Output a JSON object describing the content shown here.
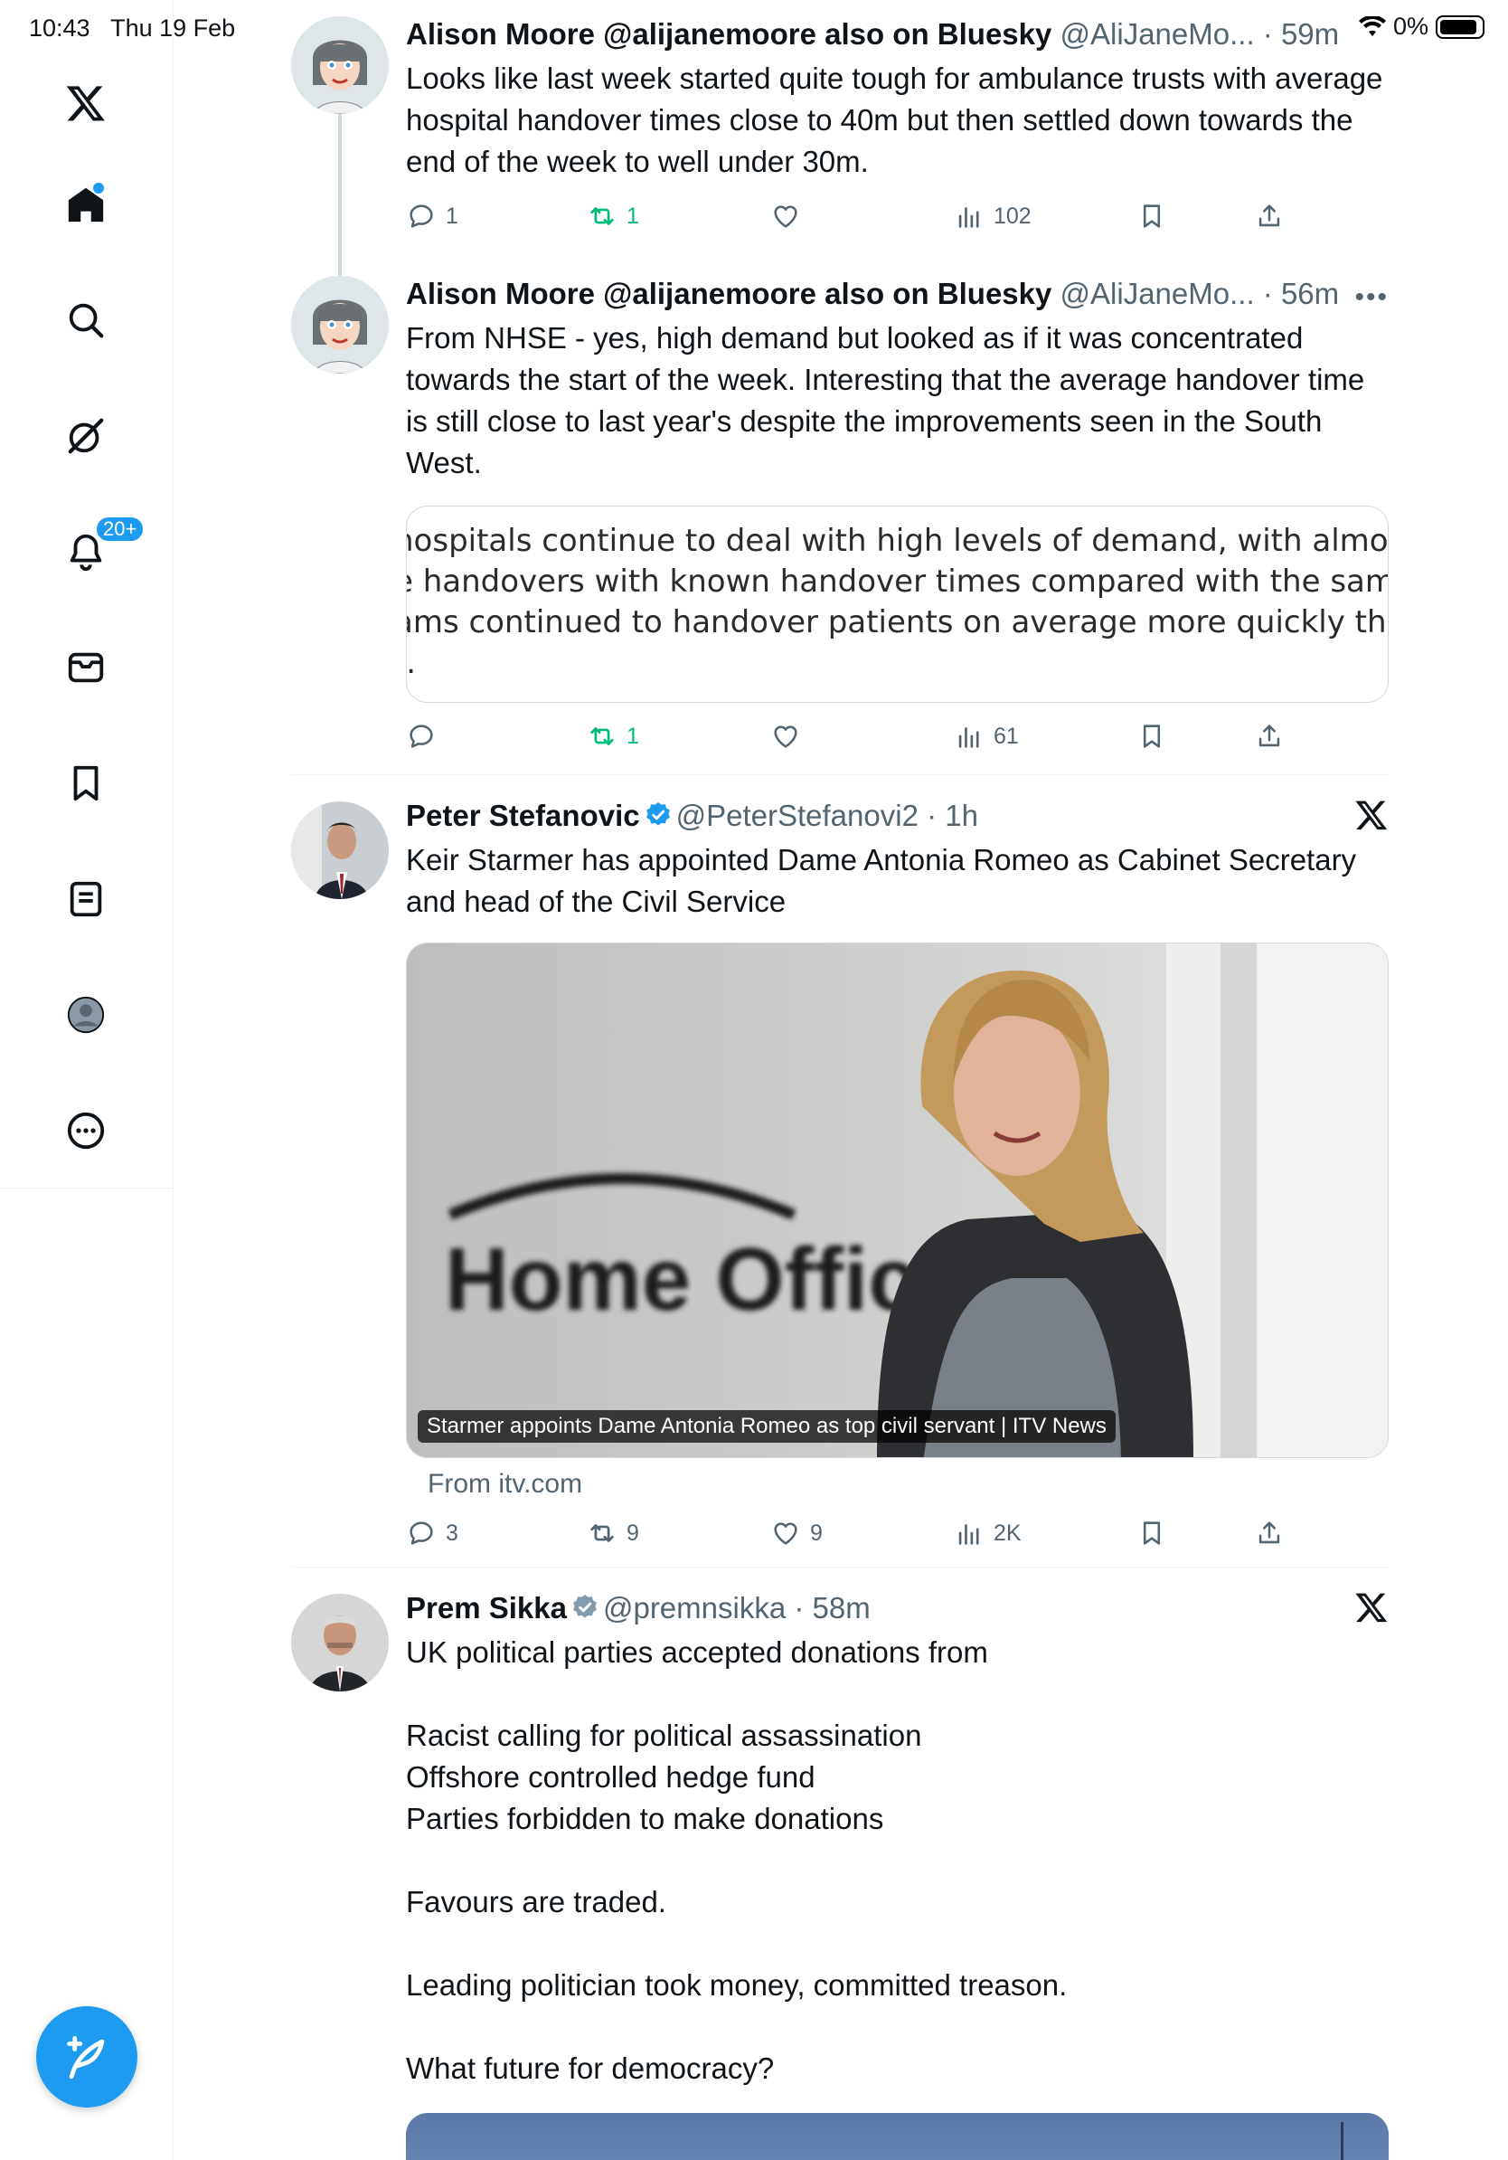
{
  "status_bar": {
    "time": "10:43",
    "date": "Thu 19 Feb",
    "battery": "0%"
  },
  "sidebar": {
    "items": [
      {
        "name": "logo",
        "icon": "x-logo-icon"
      },
      {
        "name": "home",
        "icon": "home-icon"
      },
      {
        "name": "explore",
        "icon": "search-icon"
      },
      {
        "name": "grok",
        "icon": "grok-icon"
      },
      {
        "name": "notifications",
        "icon": "bell-icon",
        "badge": "20+"
      },
      {
        "name": "messages",
        "icon": "mail-icon"
      },
      {
        "name": "bookmarks",
        "icon": "bookmark-icon"
      },
      {
        "name": "lists",
        "icon": "list-icon"
      },
      {
        "name": "profile",
        "icon": "profile-icon"
      },
      {
        "name": "more",
        "icon": "more-circle-icon"
      }
    ],
    "compose": {
      "icon": "compose-feather-icon"
    }
  },
  "tweets": [
    {
      "name": "Alison Moore @alijanemoore also on Bluesky",
      "handle": "@AliJaneMo...",
      "time": "· 59m",
      "text": "Looks like last week started quite tough for ambulance trusts with average hospital handover times close to 40m but then settled down towards the end of the week to well under 30m.",
      "replies": "1",
      "reposts": "1",
      "likes": "",
      "views": "102"
    },
    {
      "name": "Alison Moore @alijanemoore also on Bluesky",
      "handle": "@AliJaneMo...",
      "time": "· 56m",
      "text": "From NHSE - yes, high demand but looked as if it was concentrated towards the start of the week. Interesting that the average handover time is still close to last year's despite the improvements seen in the South West.",
      "quote_lines": [
        "hospitals continue to deal with high levels of demand, with almost",
        "e handovers with known handover times compared with the same",
        "ams continued to handover patients on average more quickly than",
        ")."
      ],
      "replies": "",
      "reposts": "1",
      "likes": "",
      "views": "61"
    },
    {
      "name": "Peter Stefanovic",
      "handle": "@PeterStefanovi2",
      "time": "· 1h",
      "text": "Keir Starmer has appointed Dame Antonia Romeo as Cabinet Secretary and head of the Civil Service",
      "media_caption": "Starmer appoints Dame Antonia Romeo as top civil servant | ITV News",
      "media_sign": "Home Office",
      "from": "From itv.com",
      "replies": "3",
      "reposts": "9",
      "likes": "9",
      "views": "2K"
    },
    {
      "name": "Prem Sikka",
      "handle": "@premnsikka",
      "time": "· 58m",
      "text": "UK political parties accepted donations from\n\nRacist calling for political assassination\nOffshore controlled hedge fund\nParties forbidden to make donations\n\nFavours are traded.\n\nLeading politician took money, committed treason.\n\nWhat future for democracy?"
    }
  ],
  "colors": {
    "accent": "#1d9bf0",
    "repost_green": "#00ba7c",
    "secondary_text": "#536471"
  }
}
